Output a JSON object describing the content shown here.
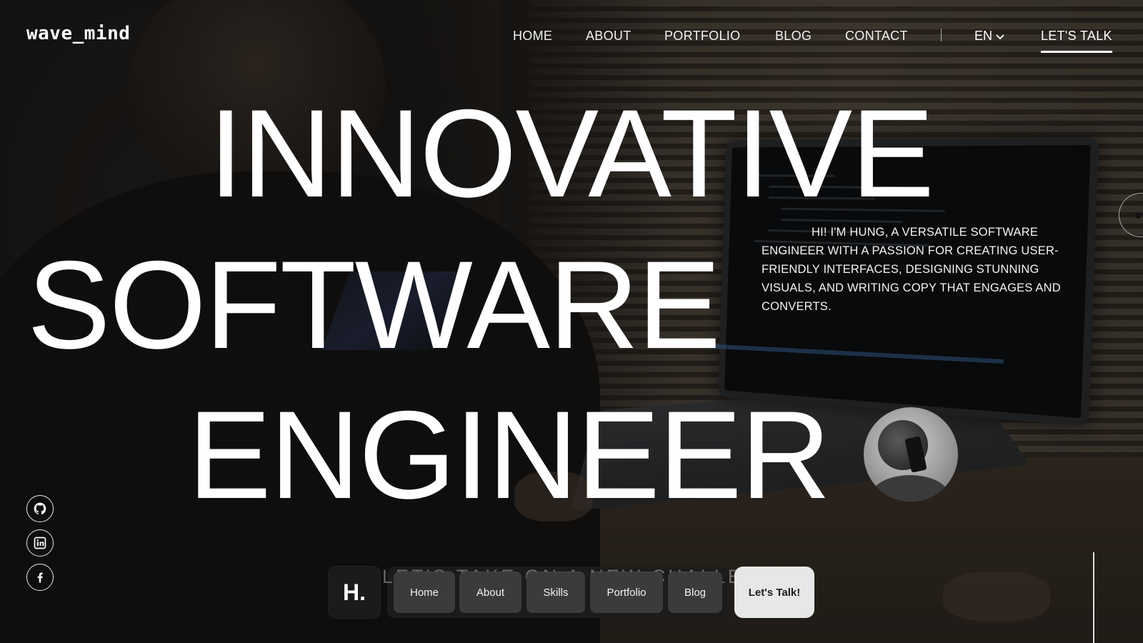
{
  "brand": {
    "logo_text": "wave_mind"
  },
  "nav": {
    "items": [
      {
        "label": "HOME"
      },
      {
        "label": "ABOUT"
      },
      {
        "label": "PORTFOLIO"
      },
      {
        "label": "BLOG"
      },
      {
        "label": "CONTACT"
      }
    ],
    "language": "EN",
    "cta_label": "LET'S TALK"
  },
  "hero": {
    "headline_lines": [
      "INNOVATIVE",
      "SOFTWARE",
      "ENGINEER"
    ],
    "intro_text": "HI! I'M HUNG, A VERSATILE SOFTWARE ENGINEER WITH A PASSION FOR CREATING USER-FRIENDLY INTERFACES, DESIGNING STUNNING VISUALS, AND WRITING COPY THAT ENGAGES AND CONVERTS."
  },
  "social": [
    {
      "icon": "github-icon"
    },
    {
      "icon": "linkedin-icon"
    },
    {
      "icon": "facebook-icon"
    }
  ],
  "dock": {
    "logo_text": "H.",
    "ghost_text": "LET'S TAKE ON A NEW CHALLENGE",
    "items": [
      {
        "label": "Home"
      },
      {
        "label": "About"
      },
      {
        "label": "Skills"
      },
      {
        "label": "Portfolio"
      },
      {
        "label": "Blog"
      }
    ],
    "cta_label": "Let's Talk!"
  },
  "colors": {
    "text": "#ffffff",
    "dock_background": "#1b1b1b",
    "dock_button": "#3b3b3b",
    "dock_cta": "#e7e7e7"
  }
}
